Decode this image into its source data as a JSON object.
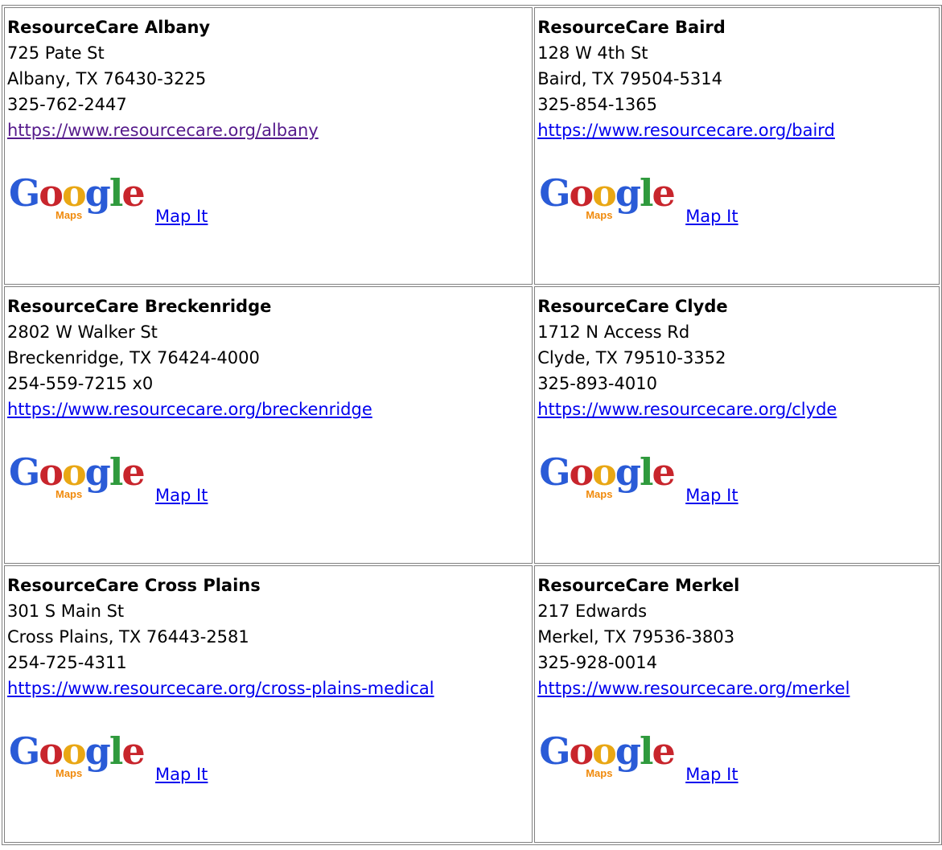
{
  "map_link_label": "Map It",
  "logo_text": "Google",
  "logo_subtext": "Maps",
  "locations": [
    {
      "name": "ResourceCare Albany",
      "street": "725 Pate St",
      "city": "Albany, TX 76430-3225",
      "phone": "325-762-2447",
      "url": "https://www.resourcecare.org/albany"
    },
    {
      "name": "ResourceCare Baird",
      "street": "128 W 4th St",
      "city": "Baird, TX 79504-5314",
      "phone": "325-854-1365",
      "url": "https://www.resourcecare.org/baird"
    },
    {
      "name": "ResourceCare Breckenridge",
      "street": "2802 W Walker St",
      "city": "Breckenridge, TX 76424-4000",
      "phone": "254-559-7215 x0",
      "url": "https://www.resourcecare.org/breckenridge"
    },
    {
      "name": "ResourceCare Clyde",
      "street": "1712 N Access Rd",
      "city": "Clyde, TX 79510-3352",
      "phone": "325-893-4010",
      "url": "https://www.resourcecare.org/clyde"
    },
    {
      "name": "ResourceCare Cross Plains",
      "street": "301 S Main St",
      "city": "Cross Plains, TX 76443-2581",
      "phone": "254-725-4311",
      "url": "https://www.resourcecare.org/cross-plains-medical"
    },
    {
      "name": "ResourceCare Merkel",
      "street": "217 Edwards",
      "city": "Merkel, TX 79536-3803",
      "phone": "325-928-0014",
      "url": "https://www.resourcecare.org/merkel"
    }
  ],
  "colors": {
    "link": "#0000ee",
    "visited_link": "#551a8b",
    "border": "#808080"
  }
}
